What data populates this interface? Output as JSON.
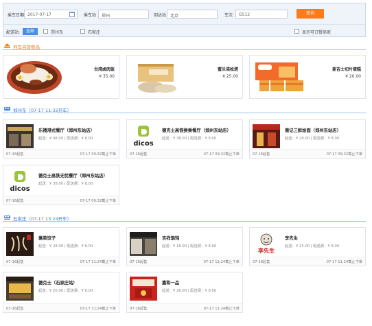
{
  "search": {
    "date_label": "乘车日期",
    "date_value": "2017-07-17",
    "from_label": "乘车站",
    "from_value": "郑州",
    "to_label": "到达站",
    "to_value": "北京",
    "train_label": "车次",
    "train_value": "G512",
    "query_button": "查询"
  },
  "filter": {
    "station_label": "配送站:",
    "all_label": "全部",
    "options": [
      "郑州东",
      "石家庄"
    ],
    "only_order_label": "显示可订餐商家"
  },
  "colors": {
    "accent_orange": "#ff7a1a",
    "accent_blue": "#3b7dd8"
  },
  "sections": {
    "train_food": {
      "title": "列车自营餐品",
      "icon": "cart-icon"
    },
    "zhengzhou": {
      "title": "郑州东（07-17 11:32开车）",
      "icon": "train-icon"
    },
    "shijiazhuang": {
      "title": "石家庄（07-17 13:24开车）",
      "icon": "train-icon"
    }
  },
  "products": [
    {
      "name": "台湾卤肉饭",
      "price": "¥ 35.00",
      "image": "braised-pork-rice-image"
    },
    {
      "name": "蜜兰诺松塔",
      "price": "¥ 25.00",
      "image": "pastry-box-image"
    },
    {
      "name": "麦吉士切片蛋糕",
      "price": "¥ 20.00",
      "image": "mages-cake-image"
    }
  ],
  "zhengzhou_restaurants": [
    {
      "name": "乐禧港式餐厅（郑州东站店）",
      "info": "起送：¥ 48.00 | 配送费：¥ 8.00",
      "open": "07-16起售",
      "deadline": "07-17 09:32截止下单",
      "image": "store-front-image"
    },
    {
      "name": "德克士高铁换乘餐厅（郑州东站店）",
      "info": "起送：¥ 38.00 | 配送费：¥ 8.00",
      "open": "07-16起售",
      "deadline": "07-17 09:32截止下单",
      "image": "dicos-logo",
      "logo_text": "dicos"
    },
    {
      "name": "萧记三鲜烩面（郑州东站店）",
      "info": "起送：¥ 28.00 | 配送费：¥ 8.00",
      "open": "07-16起售",
      "deadline": "07-17 09:32截止下单",
      "image": "noodle-shop-image"
    },
    {
      "name": "德克士高铁无忧餐厅（郑州东站店）",
      "info": "起送：¥ 38.00 | 配送费：¥ 8.00",
      "open": "07-16起售",
      "deadline": "07-17 09:32截止下单",
      "image": "dicos-logo",
      "logo_text": "dicos"
    }
  ],
  "shijiazhuang_restaurants": [
    {
      "name": "惠美饺子",
      "info": "起送：¥ 28.00 | 配送费：¥ 8.00",
      "open": "07-16起售",
      "deadline": "07-17 11:24截止下单",
      "image": "dumpling-logo"
    },
    {
      "name": "吉祥馄饨",
      "info": "起送：¥ 18.00 | 配送费：¥ 8.00",
      "open": "07-16起售",
      "deadline": "07-17 11:24截止下单",
      "image": "wonton-shop-image"
    },
    {
      "name": "李先生",
      "info": "起送：¥ 25.00 | 配送费：¥ 8.00",
      "open": "07-16起售",
      "deadline": "07-17 11:24截止下单",
      "image": "mr-lee-logo",
      "logo_text": "李先生"
    },
    {
      "name": "德克士（石家庄站）",
      "info": "起送：¥ 20.00 | 配送费：¥ 8.00",
      "open": "07-16起售",
      "deadline": "07-17 11:24截止下单",
      "image": "dicos-store-image"
    },
    {
      "name": "嘉和一品",
      "info": "起送：¥ 28.00 | 配送费：¥ 8.00",
      "open": "07-16起售",
      "deadline": "07-17 11:24截止下单",
      "image": "jiahe-logo"
    }
  ]
}
